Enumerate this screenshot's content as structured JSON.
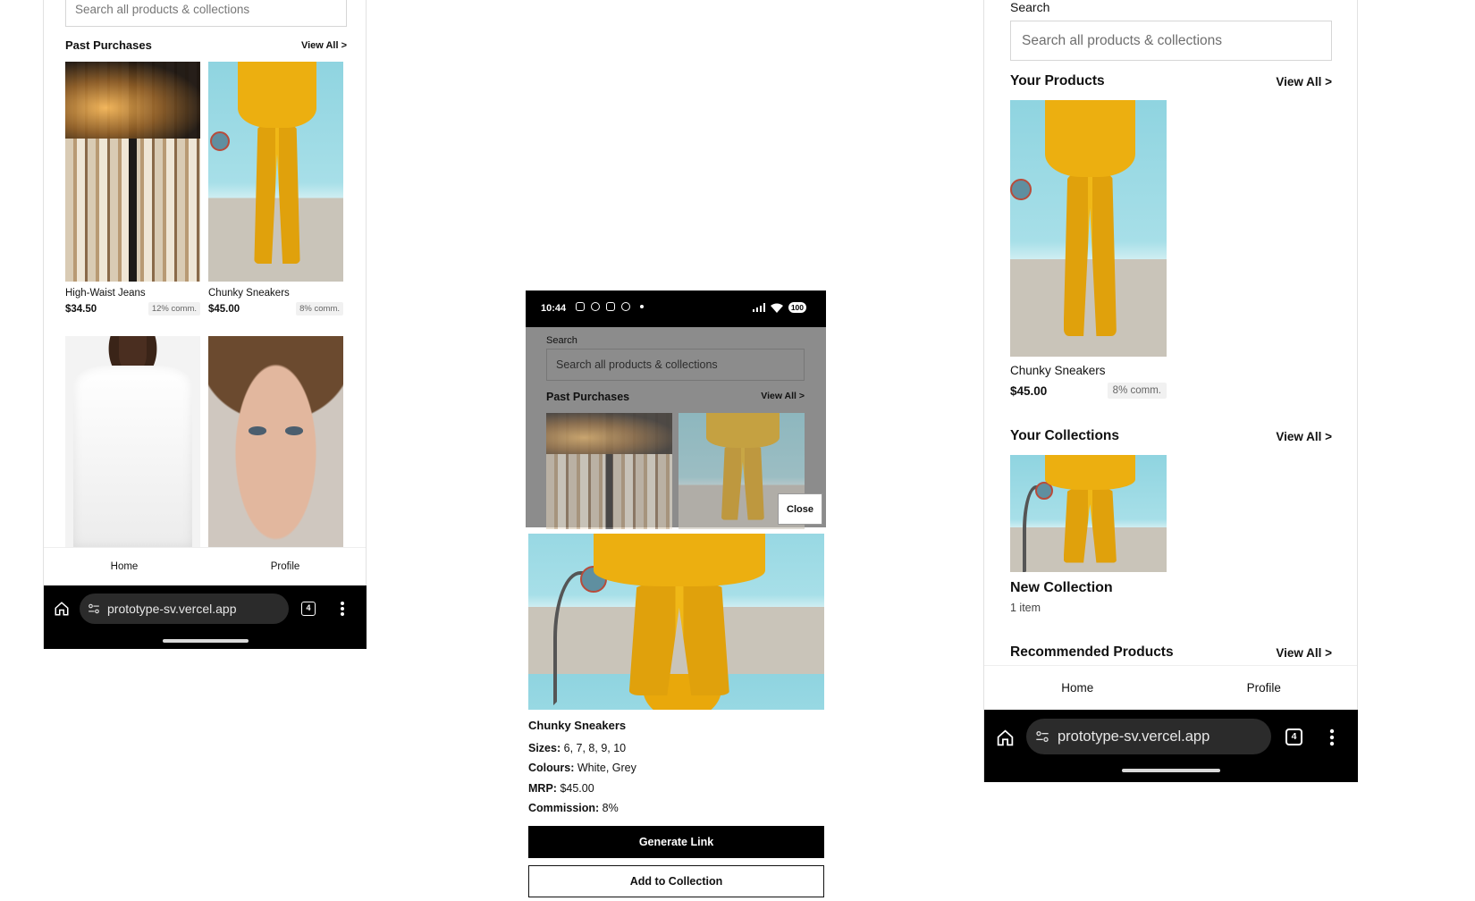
{
  "left_phone": {
    "search_placeholder": "Search all products & collections",
    "section_title": "Past Purchases",
    "view_all": "View All >",
    "products": [
      {
        "name": "High-Waist Jeans",
        "price": "$34.50",
        "commission": "12% comm."
      },
      {
        "name": "Chunky Sneakers",
        "price": "$45.00",
        "commission": "8% comm."
      }
    ],
    "tabs": [
      "Home",
      "Profile"
    ],
    "browser": {
      "url": "prototype-sv.vercel.app",
      "tab_count": "4"
    }
  },
  "middle_phone": {
    "status": {
      "time": "10:44",
      "battery": "100"
    },
    "search_label": "Search",
    "search_placeholder": "Search all products & collections",
    "section_title": "Past Purchases",
    "view_all": "View All >",
    "close_label": "Close",
    "detail": {
      "title": "Chunky Sneakers",
      "sizes_label": "Sizes:",
      "sizes": "6, 7, 8, 9, 10",
      "colours_label": "Colours:",
      "colours": "White, Grey",
      "mrp_label": "MRP:",
      "mrp": "$45.00",
      "commission_label": "Commission:",
      "commission": "8%"
    },
    "generate_link": "Generate Link",
    "add_to_collection": "Add to Collection"
  },
  "right_phone": {
    "search_label": "Search",
    "search_placeholder": "Search all products & collections",
    "your_products": "Your Products",
    "your_collections": "Your Collections",
    "recommended": "Recommended Products",
    "view_all": "View All >",
    "product": {
      "name": "Chunky Sneakers",
      "price": "$45.00",
      "commission": "8% comm."
    },
    "collection": {
      "name": "New Collection",
      "count": "1 item"
    },
    "tabs": [
      "Home",
      "Profile"
    ],
    "browser": {
      "url": "prototype-sv.vercel.app",
      "tab_count": "4"
    }
  },
  "icons": [
    "home-icon",
    "site-settings-icon",
    "tabs-icon",
    "more-menu-icon",
    "wifi-icon",
    "signal-icon",
    "battery-icon"
  ]
}
